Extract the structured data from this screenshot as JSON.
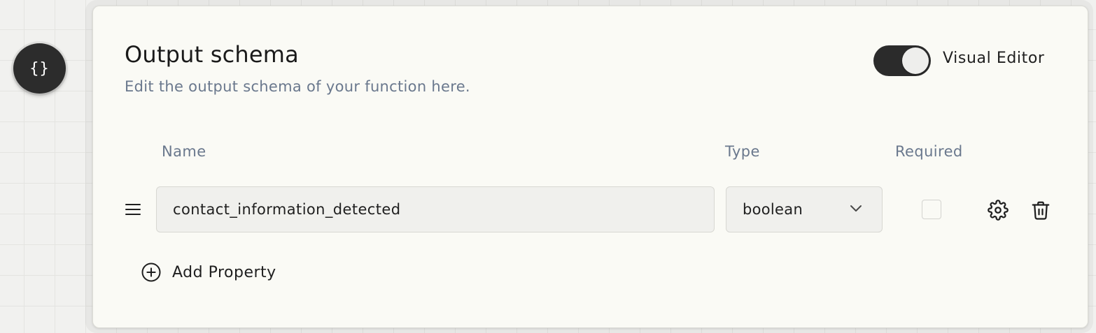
{
  "node": {
    "icon": "curly-braces-icon",
    "glyph": "{}"
  },
  "panel": {
    "title": "Output schema",
    "subtitle": "Edit the output schema of your function here.",
    "toggle": {
      "label": "Visual Editor",
      "on": true
    }
  },
  "table": {
    "headers": {
      "name": "Name",
      "type": "Type",
      "required": "Required"
    },
    "rows": [
      {
        "name": "contact_information_detected",
        "type": "boolean",
        "required": false
      }
    ]
  },
  "actions": {
    "add_property": "Add Property"
  },
  "colors": {
    "background": "#f1f1ef",
    "panel": "#fafaf5",
    "title_text": "#1a1a1a",
    "muted_text": "#6a788d",
    "toggle_track": "#2b2b2b",
    "input_background": "#f0f0ed"
  }
}
